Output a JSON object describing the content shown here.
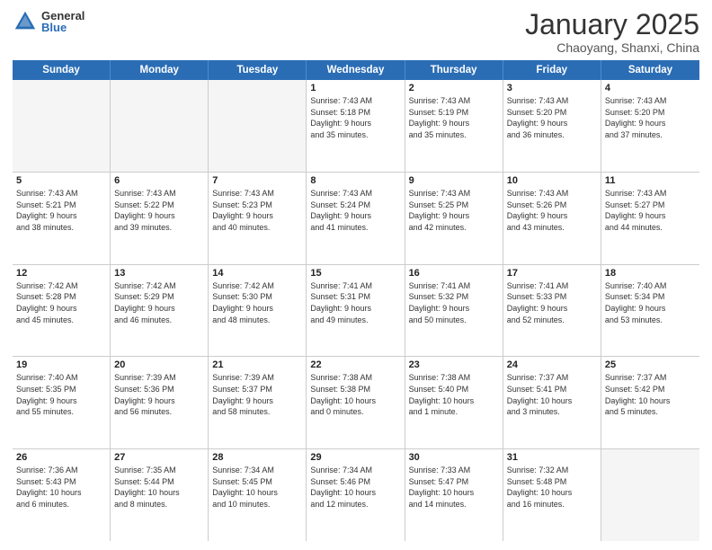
{
  "logo": {
    "general": "General",
    "blue": "Blue"
  },
  "title": "January 2025",
  "location": "Chaoyang, Shanxi, China",
  "days": [
    "Sunday",
    "Monday",
    "Tuesday",
    "Wednesday",
    "Thursday",
    "Friday",
    "Saturday"
  ],
  "weeks": [
    [
      {
        "day": "",
        "content": ""
      },
      {
        "day": "",
        "content": ""
      },
      {
        "day": "",
        "content": ""
      },
      {
        "day": "1",
        "content": "Sunrise: 7:43 AM\nSunset: 5:18 PM\nDaylight: 9 hours\nand 35 minutes."
      },
      {
        "day": "2",
        "content": "Sunrise: 7:43 AM\nSunset: 5:19 PM\nDaylight: 9 hours\nand 35 minutes."
      },
      {
        "day": "3",
        "content": "Sunrise: 7:43 AM\nSunset: 5:20 PM\nDaylight: 9 hours\nand 36 minutes."
      },
      {
        "day": "4",
        "content": "Sunrise: 7:43 AM\nSunset: 5:20 PM\nDaylight: 9 hours\nand 37 minutes."
      }
    ],
    [
      {
        "day": "5",
        "content": "Sunrise: 7:43 AM\nSunset: 5:21 PM\nDaylight: 9 hours\nand 38 minutes."
      },
      {
        "day": "6",
        "content": "Sunrise: 7:43 AM\nSunset: 5:22 PM\nDaylight: 9 hours\nand 39 minutes."
      },
      {
        "day": "7",
        "content": "Sunrise: 7:43 AM\nSunset: 5:23 PM\nDaylight: 9 hours\nand 40 minutes."
      },
      {
        "day": "8",
        "content": "Sunrise: 7:43 AM\nSunset: 5:24 PM\nDaylight: 9 hours\nand 41 minutes."
      },
      {
        "day": "9",
        "content": "Sunrise: 7:43 AM\nSunset: 5:25 PM\nDaylight: 9 hours\nand 42 minutes."
      },
      {
        "day": "10",
        "content": "Sunrise: 7:43 AM\nSunset: 5:26 PM\nDaylight: 9 hours\nand 43 minutes."
      },
      {
        "day": "11",
        "content": "Sunrise: 7:43 AM\nSunset: 5:27 PM\nDaylight: 9 hours\nand 44 minutes."
      }
    ],
    [
      {
        "day": "12",
        "content": "Sunrise: 7:42 AM\nSunset: 5:28 PM\nDaylight: 9 hours\nand 45 minutes."
      },
      {
        "day": "13",
        "content": "Sunrise: 7:42 AM\nSunset: 5:29 PM\nDaylight: 9 hours\nand 46 minutes."
      },
      {
        "day": "14",
        "content": "Sunrise: 7:42 AM\nSunset: 5:30 PM\nDaylight: 9 hours\nand 48 minutes."
      },
      {
        "day": "15",
        "content": "Sunrise: 7:41 AM\nSunset: 5:31 PM\nDaylight: 9 hours\nand 49 minutes."
      },
      {
        "day": "16",
        "content": "Sunrise: 7:41 AM\nSunset: 5:32 PM\nDaylight: 9 hours\nand 50 minutes."
      },
      {
        "day": "17",
        "content": "Sunrise: 7:41 AM\nSunset: 5:33 PM\nDaylight: 9 hours\nand 52 minutes."
      },
      {
        "day": "18",
        "content": "Sunrise: 7:40 AM\nSunset: 5:34 PM\nDaylight: 9 hours\nand 53 minutes."
      }
    ],
    [
      {
        "day": "19",
        "content": "Sunrise: 7:40 AM\nSunset: 5:35 PM\nDaylight: 9 hours\nand 55 minutes."
      },
      {
        "day": "20",
        "content": "Sunrise: 7:39 AM\nSunset: 5:36 PM\nDaylight: 9 hours\nand 56 minutes."
      },
      {
        "day": "21",
        "content": "Sunrise: 7:39 AM\nSunset: 5:37 PM\nDaylight: 9 hours\nand 58 minutes."
      },
      {
        "day": "22",
        "content": "Sunrise: 7:38 AM\nSunset: 5:38 PM\nDaylight: 10 hours\nand 0 minutes."
      },
      {
        "day": "23",
        "content": "Sunrise: 7:38 AM\nSunset: 5:40 PM\nDaylight: 10 hours\nand 1 minute."
      },
      {
        "day": "24",
        "content": "Sunrise: 7:37 AM\nSunset: 5:41 PM\nDaylight: 10 hours\nand 3 minutes."
      },
      {
        "day": "25",
        "content": "Sunrise: 7:37 AM\nSunset: 5:42 PM\nDaylight: 10 hours\nand 5 minutes."
      }
    ],
    [
      {
        "day": "26",
        "content": "Sunrise: 7:36 AM\nSunset: 5:43 PM\nDaylight: 10 hours\nand 6 minutes."
      },
      {
        "day": "27",
        "content": "Sunrise: 7:35 AM\nSunset: 5:44 PM\nDaylight: 10 hours\nand 8 minutes."
      },
      {
        "day": "28",
        "content": "Sunrise: 7:34 AM\nSunset: 5:45 PM\nDaylight: 10 hours\nand 10 minutes."
      },
      {
        "day": "29",
        "content": "Sunrise: 7:34 AM\nSunset: 5:46 PM\nDaylight: 10 hours\nand 12 minutes."
      },
      {
        "day": "30",
        "content": "Sunrise: 7:33 AM\nSunset: 5:47 PM\nDaylight: 10 hours\nand 14 minutes."
      },
      {
        "day": "31",
        "content": "Sunrise: 7:32 AM\nSunset: 5:48 PM\nDaylight: 10 hours\nand 16 minutes."
      },
      {
        "day": "",
        "content": ""
      }
    ]
  ]
}
